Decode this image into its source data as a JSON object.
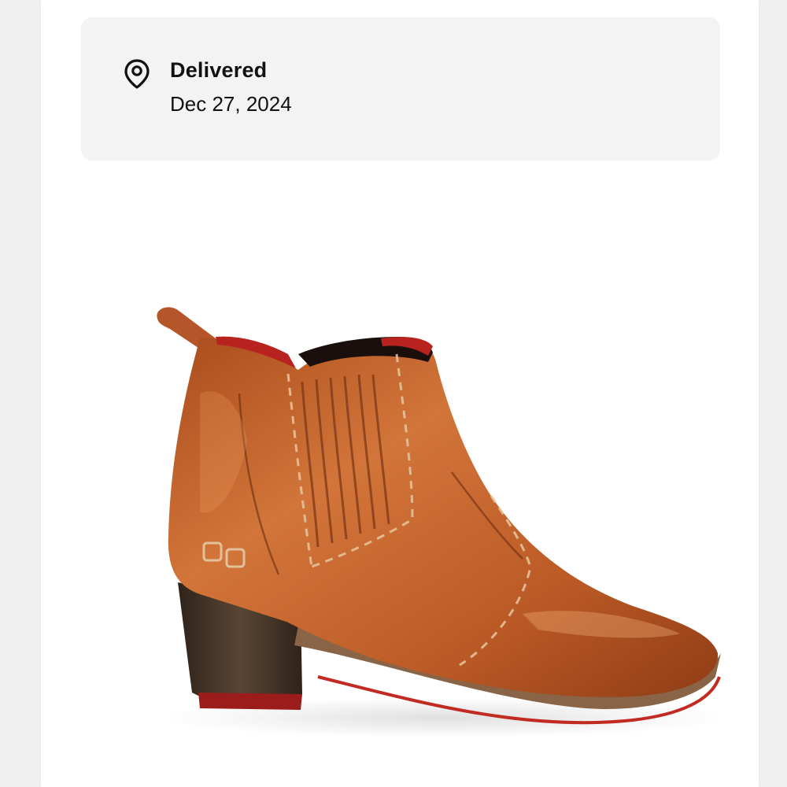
{
  "delivery": {
    "status": "Delivered",
    "date": "Dec 27, 2024",
    "icon": "location-pin-icon"
  },
  "product": {
    "image": "leather-ankle-boot-photo",
    "colors": {
      "leather": "#c0602a",
      "heel": "#3b2a20",
      "lining": "#b8221f"
    }
  }
}
